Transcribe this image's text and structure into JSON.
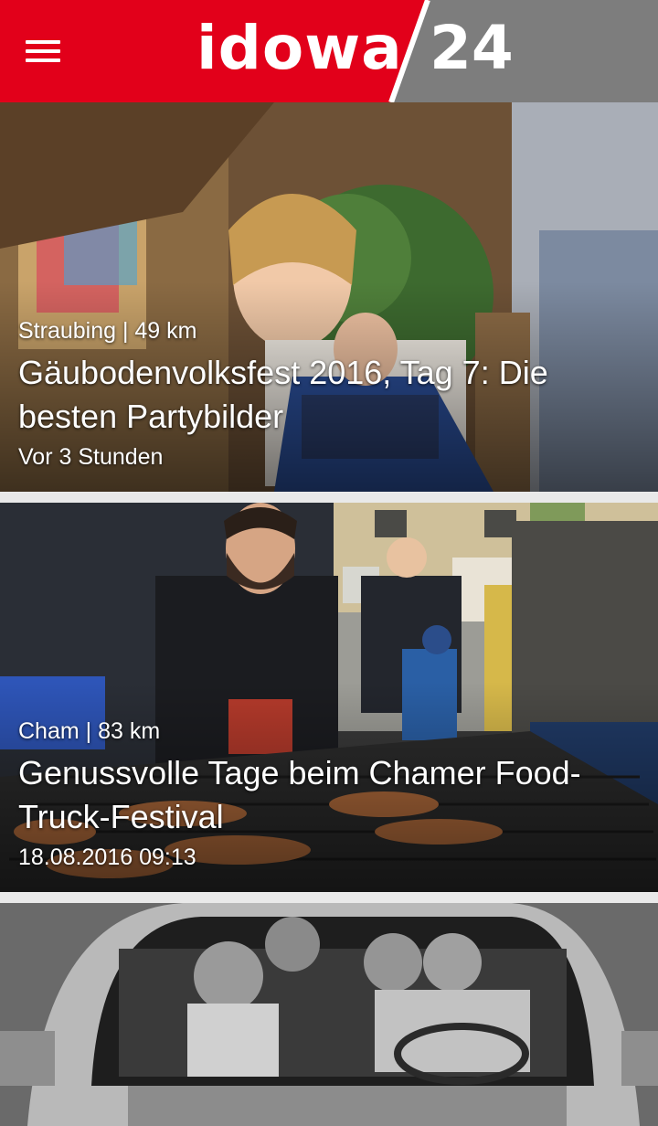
{
  "header": {
    "logo_primary": "idowa",
    "logo_secondary": "24",
    "menu_icon": "hamburger-menu-icon",
    "brand_color": "#e2001a",
    "secondary_color": "#7d7d7d"
  },
  "articles": [
    {
      "location": "Straubing | 49 km",
      "title": "Gäubodenvolksfest 2016, Tag 7: Die besten Partybilder",
      "time": "Vor 3 Stunden"
    },
    {
      "location": "Cham | 83 km",
      "title": "Genussvolle Tage beim Chamer Food-Truck-Festival",
      "time": "18.08.2016 09:13"
    },
    {
      "location": "",
      "title": "",
      "time": ""
    }
  ]
}
